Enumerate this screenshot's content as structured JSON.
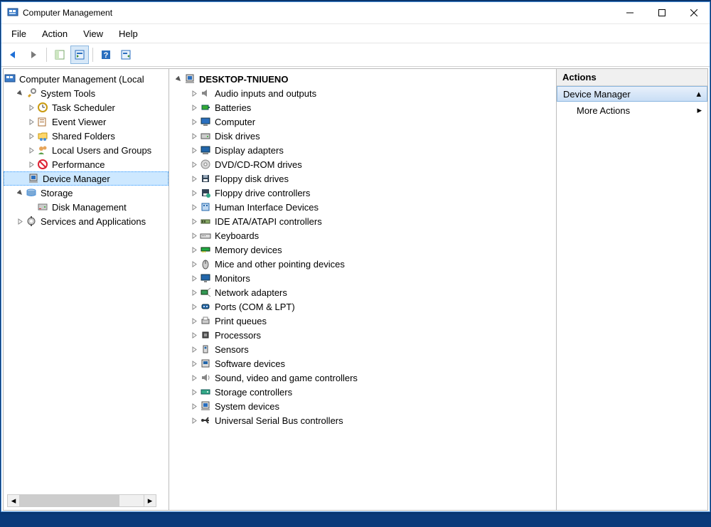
{
  "window": {
    "title": "Computer Management"
  },
  "menu": {
    "file": "File",
    "action": "Action",
    "view": "View",
    "help": "Help"
  },
  "nav": {
    "root": "Computer Management (Local",
    "system_tools": "System Tools",
    "task_scheduler": "Task Scheduler",
    "event_viewer": "Event Viewer",
    "shared_folders": "Shared Folders",
    "local_users": "Local Users and Groups",
    "performance": "Performance",
    "device_manager": "Device Manager",
    "storage": "Storage",
    "disk_management": "Disk Management",
    "services_apps": "Services and Applications"
  },
  "devices": {
    "root": "DESKTOP-TNIUENO",
    "items": [
      "Audio inputs and outputs",
      "Batteries",
      "Computer",
      "Disk drives",
      "Display adapters",
      "DVD/CD-ROM drives",
      "Floppy disk drives",
      "Floppy drive controllers",
      "Human Interface Devices",
      "IDE ATA/ATAPI controllers",
      "Keyboards",
      "Memory devices",
      "Mice and other pointing devices",
      "Monitors",
      "Network adapters",
      "Ports (COM & LPT)",
      "Print queues",
      "Processors",
      "Sensors",
      "Software devices",
      "Sound, video and game controllers",
      "Storage controllers",
      "System devices",
      "Universal Serial Bus controllers"
    ]
  },
  "actions": {
    "header": "Actions",
    "selected": "Device Manager",
    "more": "More Actions"
  }
}
